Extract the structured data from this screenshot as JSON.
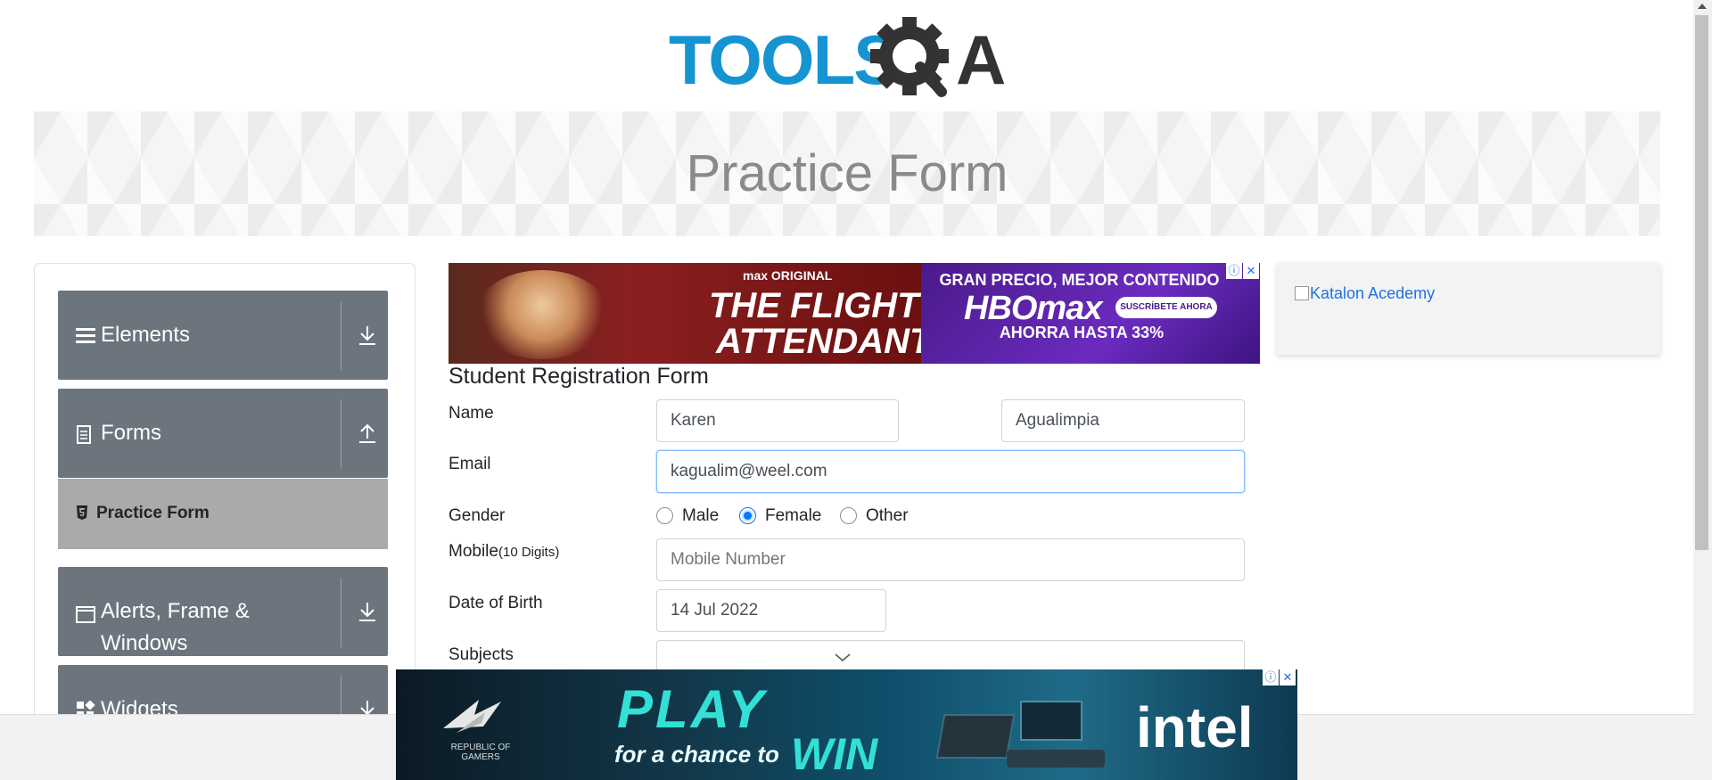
{
  "logo": {
    "text_left": "TOOLS",
    "text_right": "A"
  },
  "banner": {
    "title": "Practice Form"
  },
  "sidebar": {
    "groups": [
      {
        "label": "Elements",
        "icon": "menu-icon",
        "arrow": "download-arrow-icon"
      },
      {
        "label": "Forms",
        "icon": "document-icon",
        "arrow": "upload-arrow-icon"
      },
      {
        "label_line1": "Alerts, Frame &",
        "label_line2": "Windows",
        "icon": "window-icon",
        "arrow": "download-arrow-icon"
      },
      {
        "label": "Widgets",
        "icon": "widgets-icon",
        "arrow": "download-arrow-icon"
      }
    ],
    "active_item": {
      "label": "Practice Form",
      "icon": "html5-icon"
    }
  },
  "top_ad": {
    "brand_small": "max ORIGINAL",
    "title_line1": "THE FLIGHT",
    "title_line2": "ATTENDANT",
    "headline": "GRAN PRECIO, MEJOR CONTENIDO",
    "logo": "HBOmax",
    "cta": "SUSCRÍBETE AHORA",
    "offer": "AHORRA HASTA 33%"
  },
  "right_ad": {
    "alt": "Katalon Acedemy"
  },
  "form": {
    "title": "Student Registration Form",
    "name_label": "Name",
    "first_name": "Karen",
    "last_name": "Agualimpia",
    "email_label": "Email",
    "email": "kagualim@weel.com",
    "gender_label": "Gender",
    "gender_options": [
      "Male",
      "Female",
      "Other"
    ],
    "gender_selected": "Female",
    "mobile_label": "Mobile",
    "mobile_hint": "(10 Digits)",
    "mobile_placeholder": "Mobile Number",
    "dob_label": "Date of Birth",
    "dob": "14 Jul 2022",
    "subjects_label": "Subjects"
  },
  "bottom_ad": {
    "line1": "PLAY",
    "line2": "for a chance to",
    "line3": "WIN",
    "sponsor": "intel",
    "rog": "REPUBLIC OF GAMERS"
  }
}
